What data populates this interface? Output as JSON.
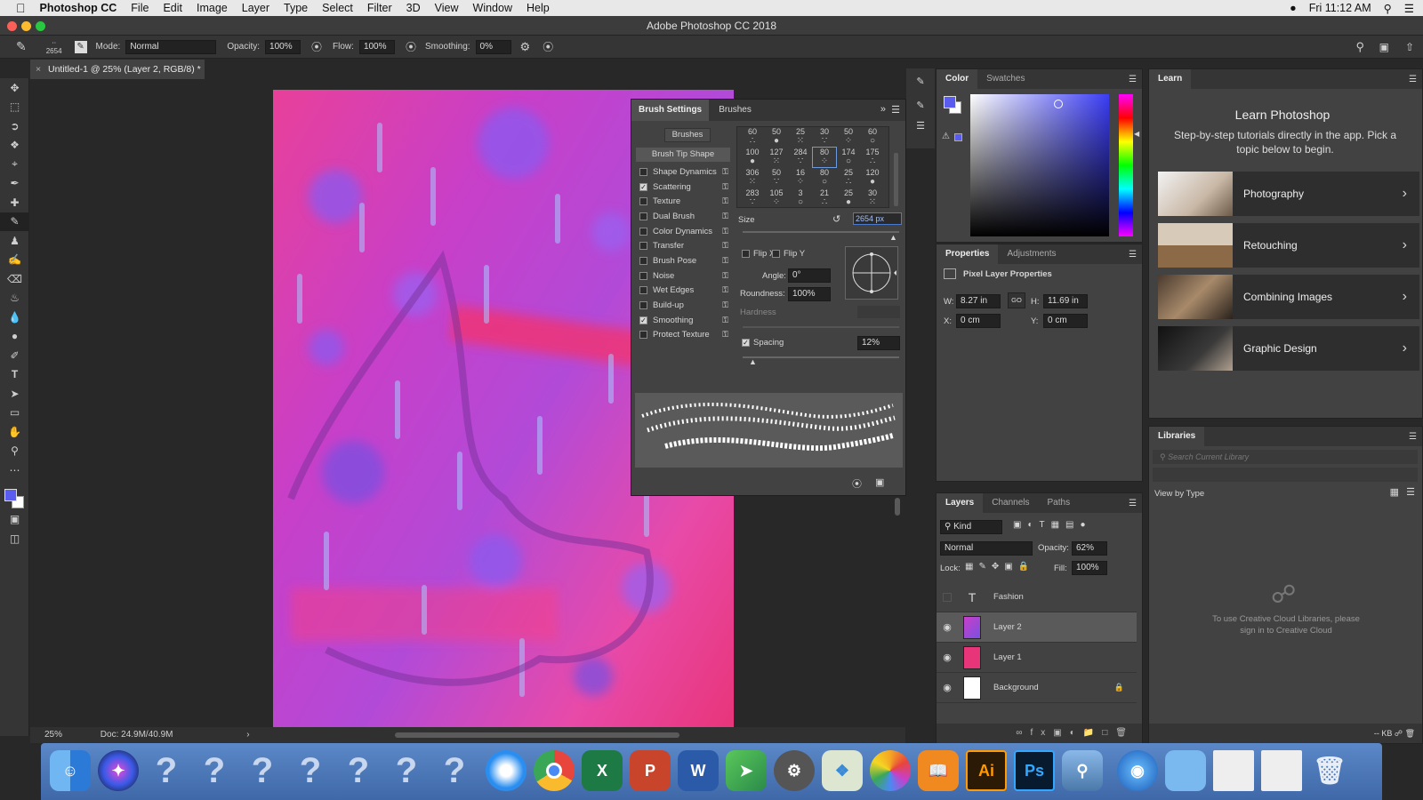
{
  "menubar": {
    "apple": "",
    "app": "Photoshop CC",
    "items": [
      "File",
      "Edit",
      "Image",
      "Layer",
      "Type",
      "Select",
      "Filter",
      "3D",
      "View",
      "Window",
      "Help"
    ],
    "clock": "Fri 11:12 AM"
  },
  "window": {
    "title": "Adobe Photoshop CC 2018"
  },
  "options": {
    "brush_size": "2654",
    "mode_label": "Mode:",
    "mode_value": "Normal",
    "opacity_label": "Opacity:",
    "opacity_value": "100%",
    "flow_label": "Flow:",
    "flow_value": "100%",
    "smoothing_label": "Smoothing:",
    "smoothing_value": "0%"
  },
  "document": {
    "tab_title": "Untitled-1 @ 25% (Layer 2, RGB/8) *",
    "zoom": "25%",
    "doc_size": "Doc: 24.9M/40.9M"
  },
  "brush_settings": {
    "tab_settings": "Brush Settings",
    "tab_brushes": "Brushes",
    "brushes_button": "Brushes",
    "tip_shape": "Brush Tip Shape",
    "options": [
      {
        "label": "Shape Dynamics",
        "checked": false
      },
      {
        "label": "Scattering",
        "checked": true
      },
      {
        "label": "Texture",
        "checked": false
      },
      {
        "label": "Dual Brush",
        "checked": false
      },
      {
        "label": "Color Dynamics",
        "checked": false
      },
      {
        "label": "Transfer",
        "checked": false
      },
      {
        "label": "Brush Pose",
        "checked": false
      },
      {
        "label": "Noise",
        "checked": false
      },
      {
        "label": "Wet Edges",
        "checked": false
      },
      {
        "label": "Build-up",
        "checked": false
      },
      {
        "label": "Smoothing",
        "checked": true
      },
      {
        "label": "Protect Texture",
        "checked": false
      }
    ],
    "brush_sizes_row1": [
      "60",
      "50",
      "25",
      "30",
      "50",
      "60"
    ],
    "brush_sizes_row2": [
      "100",
      "127",
      "284",
      "80",
      "174",
      "175"
    ],
    "brush_sizes_row3": [
      "306",
      "50",
      "16",
      "80",
      "25",
      "120"
    ],
    "brush_sizes_row4": [
      "283",
      "105",
      "3",
      "21",
      "25",
      "30"
    ],
    "size_label": "Size",
    "size_value": "2654 px",
    "flip_x": "Flip X",
    "flip_y": "Flip Y",
    "angle_label": "Angle:",
    "angle_value": "0°",
    "roundness_label": "Roundness:",
    "roundness_value": "100%",
    "hardness_label": "Hardness",
    "spacing_label": "Spacing",
    "spacing_value": "12%"
  },
  "color_panel": {
    "tab_color": "Color",
    "tab_swatches": "Swatches",
    "foreground": "#5a5cf0",
    "background": "#ffffff"
  },
  "properties": {
    "tab_properties": "Properties",
    "tab_adjustments": "Adjustments",
    "heading": "Pixel Layer Properties",
    "w_label": "W:",
    "w_value": "8.27 in",
    "h_label": "H:",
    "h_value": "11.69 in",
    "link": "GO",
    "x_label": "X:",
    "x_value": "0 cm",
    "y_label": "Y:",
    "y_value": "0 cm"
  },
  "layers_panel": {
    "tab_layers": "Layers",
    "tab_channels": "Channels",
    "tab_paths": "Paths",
    "kind": "Kind",
    "blend": "Normal",
    "opacity_label": "Opacity:",
    "opacity_value": "62%",
    "lock_label": "Lock:",
    "fill_label": "Fill:",
    "fill_value": "100%",
    "layers": [
      {
        "name": "Fashion",
        "type": "text",
        "visible": false
      },
      {
        "name": "Layer 2",
        "type": "pixel",
        "visible": true,
        "selected": true
      },
      {
        "name": "Layer 1",
        "type": "pixel",
        "visible": true
      },
      {
        "name": "Background",
        "type": "pixel",
        "visible": true,
        "locked": true
      }
    ]
  },
  "learn": {
    "tab": "Learn",
    "title": "Learn Photoshop",
    "subtitle": "Step-by-step tutorials directly in the app. Pick a topic below to begin.",
    "items": [
      "Photography",
      "Retouching",
      "Combining Images",
      "Graphic Design"
    ]
  },
  "libraries": {
    "tab": "Libraries",
    "search_placeholder": "Search Current Library",
    "view_by": "View by Type",
    "message": "To use Creative Cloud Libraries, please sign in to Creative Cloud",
    "kb": "-- KB"
  },
  "dock": {
    "items": [
      "finder-icon",
      "siri-icon",
      "placeholder-icon",
      "placeholder-icon",
      "placeholder-icon",
      "placeholder-icon",
      "placeholder-icon",
      "placeholder-icon",
      "placeholder-icon",
      "safari-icon",
      "chrome-icon",
      "excel-icon",
      "powerpoint-icon",
      "word-icon",
      "maps-icon",
      "system-preferences-icon",
      "photos-icon",
      "ibooks-icon",
      "illustrator-icon",
      "photoshop-icon",
      "preview-icon",
      "globe-icon",
      "folder-icon",
      "window-icon",
      "window-icon",
      "trash-icon"
    ],
    "ai_label": "Ai",
    "ps_label": "Ps"
  }
}
